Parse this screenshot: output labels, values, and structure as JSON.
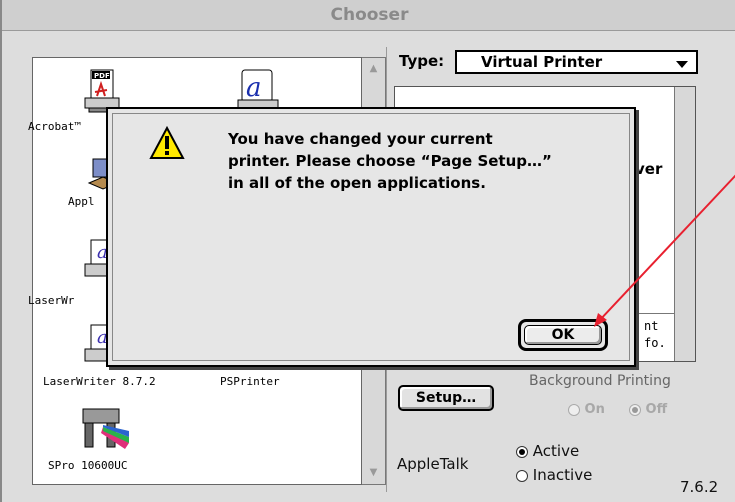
{
  "window": {
    "title": "Chooser"
  },
  "devices": [
    {
      "label": "Acrobat™",
      "icon": "acrobat-pdf-printer-icon"
    },
    {
      "label": "",
      "icon": "adobe-printer-script-icon"
    },
    {
      "label": "Appl",
      "icon": "appleshare-folder-icon"
    },
    {
      "label": "LaserWr",
      "icon": "laserwriter-printer-icon"
    },
    {
      "label": "LaserWriter 8.7.2",
      "icon": "laserwriter-printer-icon"
    },
    {
      "label": "PSPrinter",
      "icon": "psprinter-icon"
    },
    {
      "label": "SPro 10600UC",
      "icon": "epson-stylus-pro-icon"
    }
  ],
  "type_selector": {
    "label": "Type:",
    "value": "Virtual Printer"
  },
  "right_panel": {
    "partial_text": "ver",
    "partial_footer_1": "nt",
    "partial_footer_2": "fo."
  },
  "setup_button": "Setup…",
  "background_printing": {
    "label": "Background Printing",
    "on": "On",
    "off": "Off",
    "selected": "Off"
  },
  "appletalk": {
    "label": "AppleTalk",
    "active": "Active",
    "inactive": "Inactive",
    "selected": "Active"
  },
  "version": "7.6.2",
  "alert": {
    "message": "You have changed your current\nprinter. Please choose “Page Setup…”\nin all of the open applications.",
    "ok_label": "OK",
    "icon": "warning-triangle-icon"
  },
  "annotation": {
    "color": "#e8202f"
  }
}
